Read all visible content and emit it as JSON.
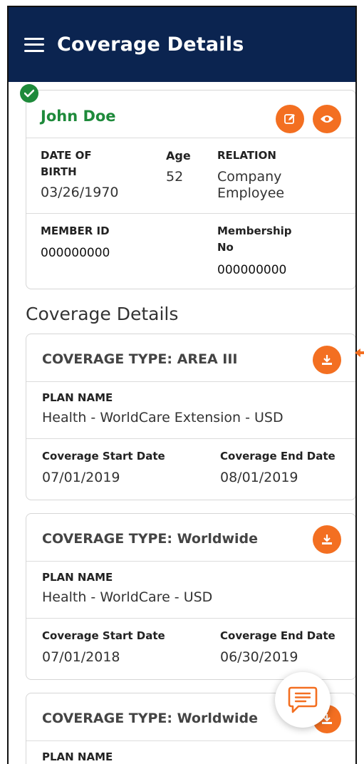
{
  "header": {
    "title": "Coverage Details",
    "menu_icon": "hamburger-menu-icon"
  },
  "member": {
    "name": "John Doe",
    "date_of_birth_label": "DATE OF BIRTH",
    "date_of_birth": "03/26/1970",
    "age_label": "Age",
    "age": "52",
    "relation_label": "RELATION",
    "relation": "Company Employee",
    "member_id_label": "MEMBER ID",
    "member_id": "000000000",
    "membership_no_label": "Membership No",
    "membership_no": "000000000",
    "edit_icon": "edit-icon",
    "view_icon": "eye-icon",
    "verified_icon": "check-icon"
  },
  "coverage_heading": "Coverage Details",
  "coverages": [
    {
      "type": "COVERAGE TYPE:  AREA III",
      "plan_label": "PLAN NAME",
      "plan_name": "Health - WorldCare Extension - USD",
      "start_label": "Coverage Start Date",
      "start_date": "07/01/2019",
      "end_label": "Coverage End Date",
      "end_date": "08/01/2019"
    },
    {
      "type": "COVERAGE TYPE:  Worldwide",
      "plan_label": "PLAN NAME",
      "plan_name": "Health - WorldCare - USD",
      "start_label": "Coverage Start Date",
      "start_date": "07/01/2018",
      "end_label": "Coverage End Date",
      "end_date": "06/30/2019"
    },
    {
      "type": "COVERAGE TYPE:  Worldwide",
      "plan_label": "PLAN NAME"
    }
  ],
  "colors": {
    "navy": "#0b2450",
    "orange": "#f36f21",
    "green": "#1e8a3b"
  },
  "chat_icon": "chat-icon"
}
